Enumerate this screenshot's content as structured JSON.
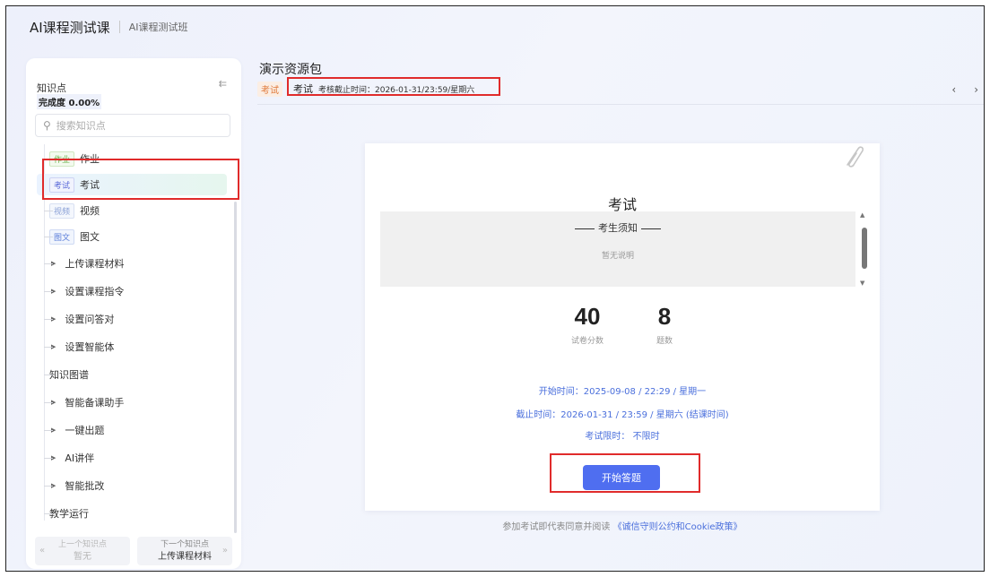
{
  "header": {
    "course_title": "AI课程测试课",
    "class_name": "AI课程测试班"
  },
  "sidebar": {
    "title": "知识点",
    "progress": "完成度 0.00%",
    "search_placeholder": "搜索知识点",
    "items": [
      {
        "tag": "作业",
        "label": "作业"
      },
      {
        "tag": "考试",
        "label": "考试"
      },
      {
        "tag": "视频",
        "label": "视频"
      },
      {
        "tag": "图文",
        "label": "图文"
      },
      {
        "label": "上传课程材料"
      },
      {
        "label": "设置课程指令"
      },
      {
        "label": "设置问答对"
      },
      {
        "label": "设置智能体"
      },
      {
        "label": "知识图谱"
      },
      {
        "label": "智能备课助手"
      },
      {
        "label": "一键出题"
      },
      {
        "label": "AI讲伴"
      },
      {
        "label": "智能批改"
      },
      {
        "label": "教学运行"
      }
    ],
    "prev": {
      "caption": "上一个知识点",
      "value": "暂无"
    },
    "next": {
      "caption": "下一个知识点",
      "value": "上传课程材料"
    }
  },
  "main": {
    "page_title": "演示资源包",
    "tag": "考试",
    "exam_name": "考试",
    "deadline": "考核截止时间：2026-01-31/23:59/星期六"
  },
  "card": {
    "title": "考试",
    "notice_title": "考生须知",
    "notice_body": "暂无说明",
    "score": "40",
    "score_label": "试卷分数",
    "count": "8",
    "count_label": "题数",
    "start_time": "开始时间：2025-09-08 / 22:29 / 星期一",
    "end_time": "截止时间：2026-01-31 / 23:59 / 星期六 (结课时间)",
    "time_limit": "考试限时： 不限时",
    "start_button": "开始答题",
    "agree_prefix": "参加考试即代表同意并阅读",
    "agree_link": "《诚信守则公约和Cookie政策》"
  }
}
